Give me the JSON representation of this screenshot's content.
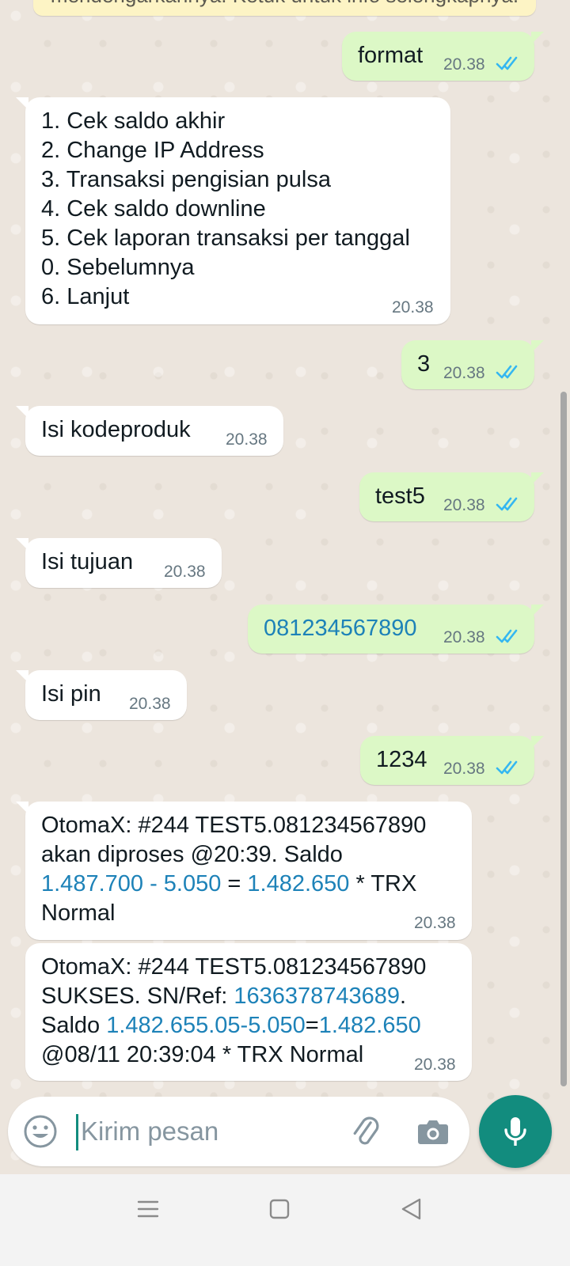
{
  "banner": {
    "text": "mendengarkannya. Ketuk untuk info selengkapnya."
  },
  "messages": [
    {
      "dir": "out",
      "text": "format",
      "time": "20.38"
    },
    {
      "dir": "in",
      "lines": [
        "1. Cek saldo akhir",
        "2. Change IP Address",
        "3. Transaksi pengisian pulsa",
        "4. Cek saldo downline",
        "5. Cek laporan transaksi per tanggal",
        "0. Sebelumnya",
        "6. Lanjut"
      ],
      "time": "20.38"
    },
    {
      "dir": "out",
      "text": "3",
      "time": "20.38"
    },
    {
      "dir": "in",
      "text": "Isi kodeproduk",
      "time": "20.38"
    },
    {
      "dir": "out",
      "text": "test5",
      "time": "20.38"
    },
    {
      "dir": "in",
      "text": "Isi tujuan",
      "time": "20.38"
    },
    {
      "dir": "out",
      "text": "081234567890",
      "time": "20.38"
    },
    {
      "dir": "in",
      "text": "Isi pin",
      "time": "20.38"
    },
    {
      "dir": "out",
      "text": "1234",
      "time": "20.38"
    },
    {
      "dir": "in",
      "line1": "OtomaX: #244 TEST5.081234567890",
      "line2": "akan diproses @20:39. Saldo",
      "l3_a": "1.487.700 - 5.050",
      "l3_b": " = ",
      "l3_c": "1.482.650",
      "l3_d": " * TRX",
      "line4": "Normal",
      "time": "20.38"
    },
    {
      "dir": "in",
      "line1": "OtomaX: #244 TEST5.081234567890",
      "l2_a": "SUKSES. SN/Ref: ",
      "l2_b": "1636378743689",
      "l2_c": ".",
      "l3_a": "Saldo ",
      "l3_b": "1.482.655.05-5.050",
      "l3_c": "=",
      "l3_d": "1.482.650",
      "line4": "@08/11 20:39:04 * TRX Normal",
      "time": "20.38"
    }
  ],
  "composer": {
    "placeholder": "Kirim pesan"
  },
  "icons": {
    "emoji": "emoji-icon",
    "attach": "paperclip-icon",
    "camera": "camera-icon",
    "mic": "mic-icon",
    "read": "double-check-icon",
    "nav_menu": "menu-icon",
    "nav_home": "home-square-icon",
    "nav_back": "back-triangle-icon"
  },
  "colors": {
    "background": "#ece5dd",
    "outgoing": "#dcf8c6",
    "incoming": "#ffffff",
    "accent": "#128c7e",
    "link": "#1d82b8",
    "read_ticks": "#34b7f1",
    "timestamp": "#667781"
  }
}
